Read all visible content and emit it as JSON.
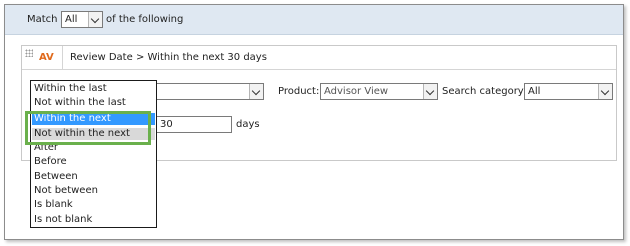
{
  "match_bar": {
    "prefix": "Match",
    "selected": "All",
    "suffix": "of the following"
  },
  "criteria": {
    "badge": "AV",
    "title": "Review Date  >  Within the next 30 days",
    "product_label": "Product:",
    "product_value": "Advisor View",
    "category_label": "Search category:",
    "category_value": "All",
    "amount_value": "30",
    "unit_label": "days"
  },
  "dropdown": {
    "options": [
      "Within the last",
      "Not within the last",
      "Within the next",
      "Not within the next",
      "After",
      "Before",
      "Between",
      "Not between",
      "Is blank",
      "Is not blank"
    ],
    "selected_index": 2,
    "hover_index": 3
  },
  "colors": {
    "header_bg": "#dfe8f2",
    "badge": "#e06a1c",
    "selection": "#3399ff",
    "highlight": "#6ab04c"
  }
}
